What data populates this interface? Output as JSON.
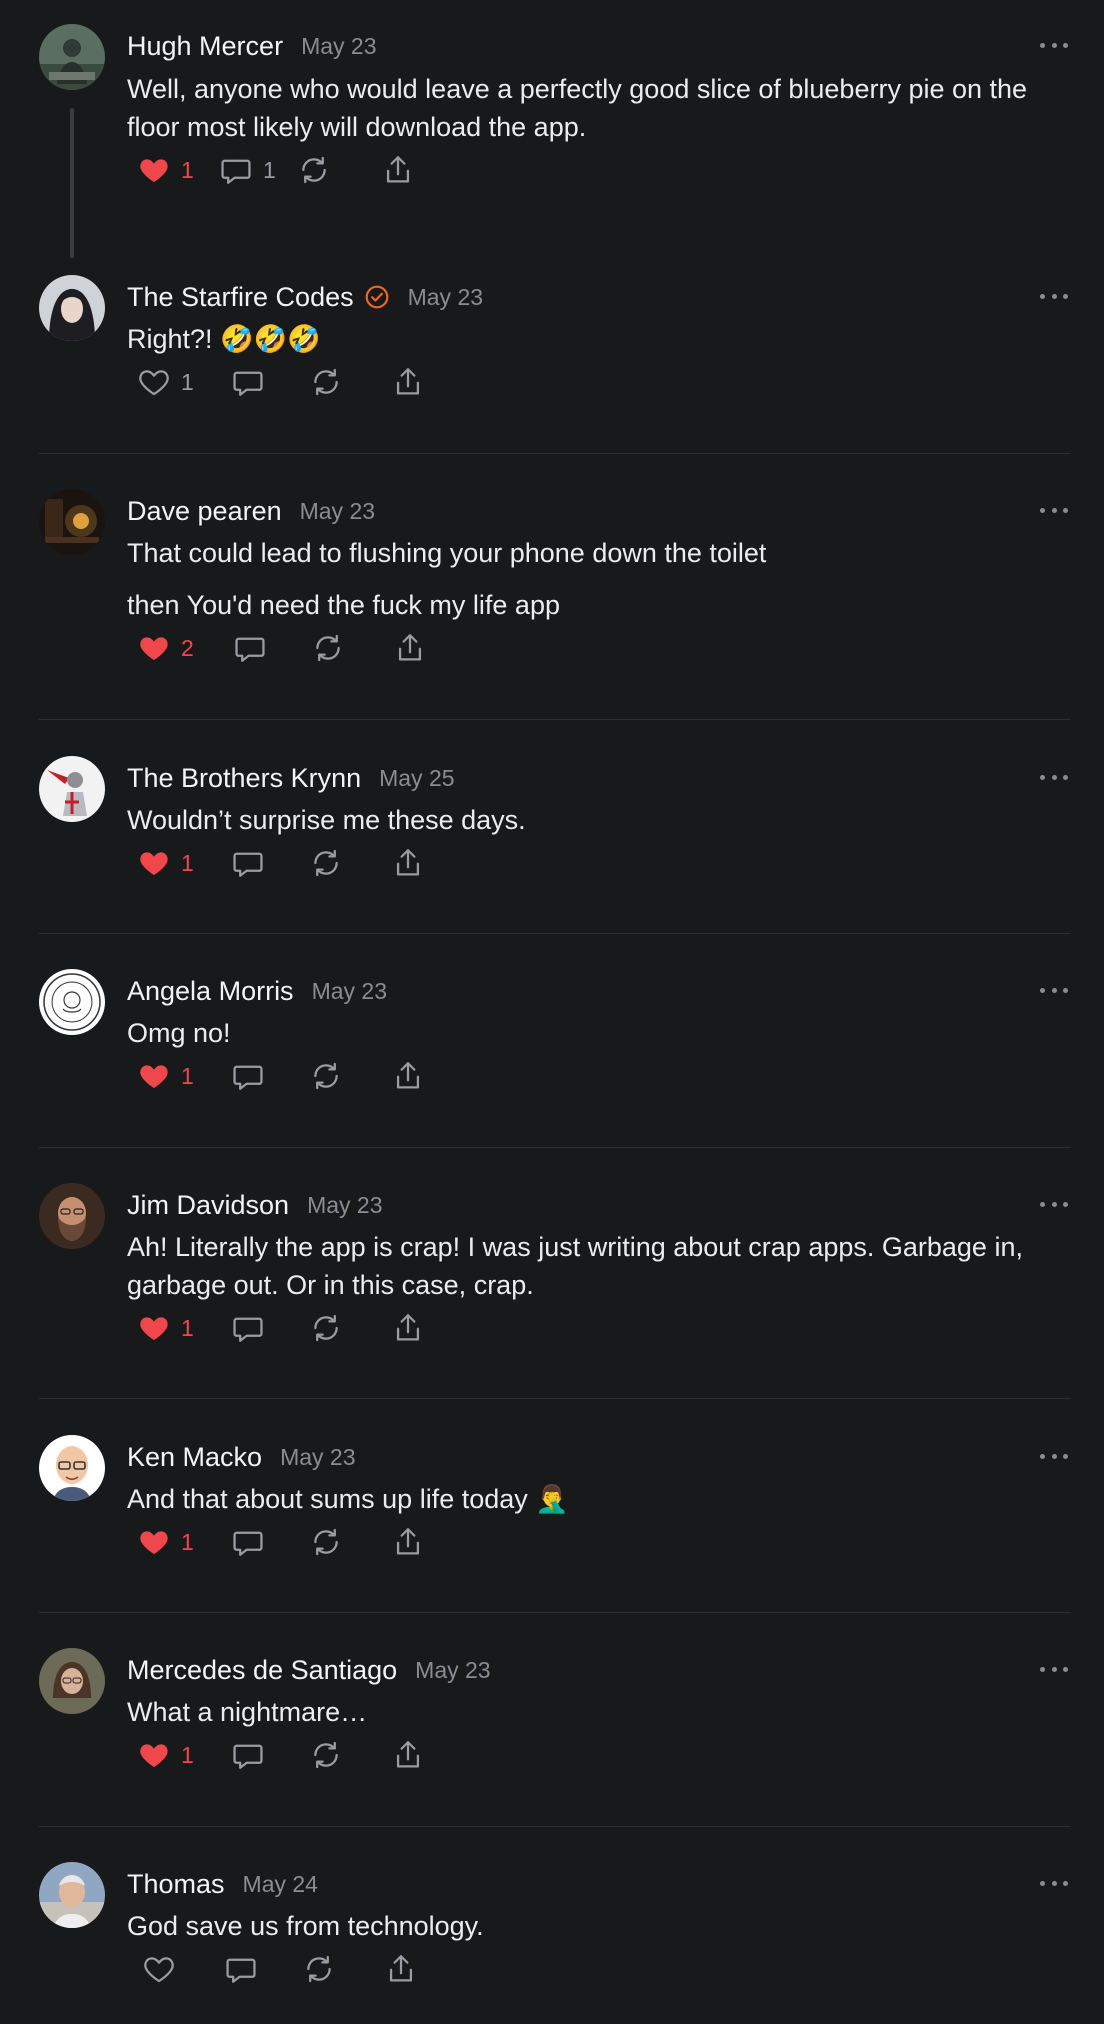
{
  "colors": {
    "background": "#18191b",
    "like_active": "#f0474d",
    "icon_muted": "#9b9ca0",
    "verified": "#f26522"
  },
  "posts": [
    {
      "author": "Hugh Mercer",
      "date": "May 23",
      "lines": [
        "Well, anyone who would leave a perfectly good slice of blueberry pie on the floor most likely will download the app."
      ],
      "liked": true,
      "likes": "1",
      "replies": "1",
      "avatar": "statue-photo"
    },
    {
      "author": "The Starfire Codes",
      "verified": true,
      "date": "May 23",
      "lines": [
        "Right?! 🤣🤣🤣"
      ],
      "liked": false,
      "likes": "1",
      "replies": "",
      "avatar": "woman-dark-hair"
    },
    {
      "author": "Dave pearen",
      "date": "May 23",
      "lines": [
        "That could lead to flushing your phone down the toilet",
        "then You'd need the fuck my life app"
      ],
      "liked": true,
      "likes": "2",
      "replies": "",
      "avatar": "dark-room-lamp"
    },
    {
      "author": "The Brothers Krynn",
      "date": "May 25",
      "lines": [
        "Wouldn’t surprise me these days."
      ],
      "liked": true,
      "likes": "1",
      "replies": "",
      "avatar": "knight-illustration"
    },
    {
      "author": "Angela Morris",
      "date": "May 23",
      "lines": [
        "Omg no!"
      ],
      "liked": true,
      "likes": "1",
      "replies": "",
      "avatar": "seal-emblem"
    },
    {
      "author": "Jim Davidson",
      "date": "May 23",
      "lines": [
        "Ah! Literally the app is crap! I was just writing about crap apps. Garbage in, garbage out. Or in this case, crap."
      ],
      "liked": true,
      "likes": "1",
      "replies": "",
      "avatar": "bearded-man"
    },
    {
      "author": "Ken Macko",
      "date": "May 23",
      "lines": [
        "And that about sums up life today 🤦‍♂️"
      ],
      "liked": true,
      "likes": "1",
      "replies": "",
      "avatar": "cartoon-bald-man"
    },
    {
      "author": "Mercedes de Santiago",
      "date": "May 23",
      "lines": [
        "What a nightmare…"
      ],
      "liked": true,
      "likes": "1",
      "replies": "",
      "avatar": "woman-glasses"
    },
    {
      "author": "Thomas",
      "date": "May 24",
      "lines": [
        "God save us from technology."
      ],
      "liked": false,
      "likes": "",
      "replies": "",
      "avatar": "older-man"
    }
  ]
}
